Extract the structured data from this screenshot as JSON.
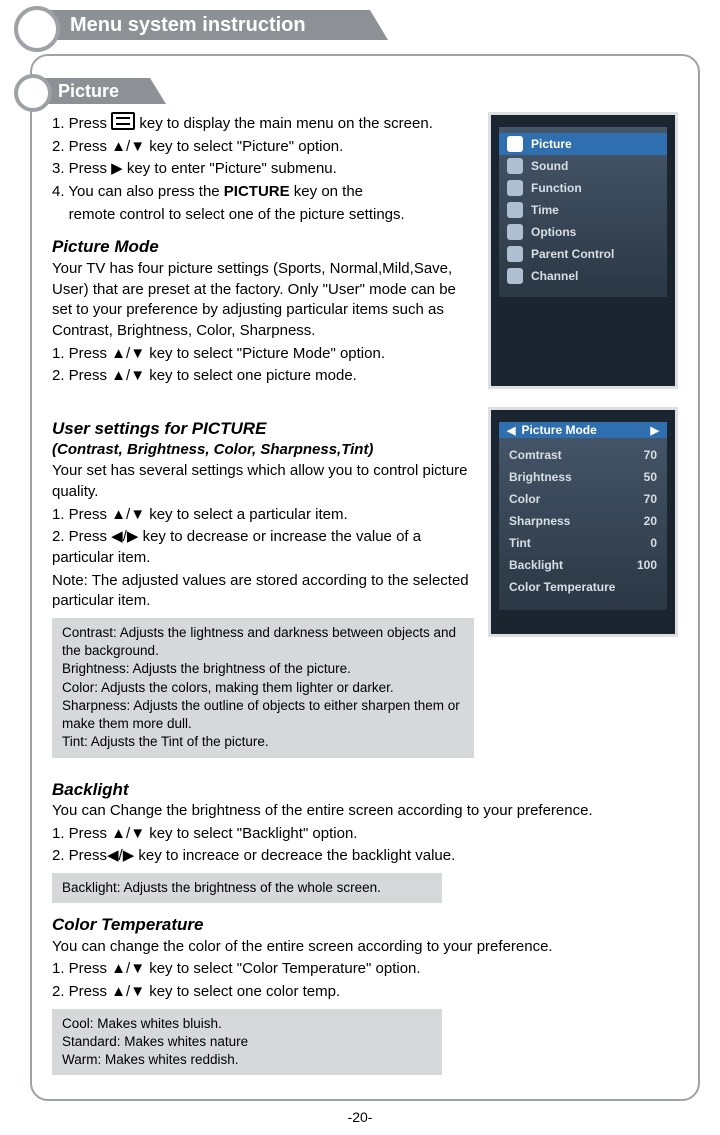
{
  "header": {
    "title": "Menu system instruction"
  },
  "section": {
    "label": "Picture"
  },
  "intro": {
    "l1a": "1. Press ",
    "l1b": " key to display the main menu on the screen.",
    "l2": "2. Press ▲/▼ key to select \"Picture\" option.",
    "l3": "3. Press ▶ key to enter \"Picture\" submenu.",
    "l4a": "4. You can also press the ",
    "l4b": "PICTURE",
    "l4c": " key on the",
    "l5": "    remote control to select one of the picture settings."
  },
  "pmode": {
    "h": "Picture Mode",
    "p1": "Your TV has four picture settings (Sports, Normal,Mild,Save, User) that are preset at the factory. Only \"User\" mode can be set to your preference by adjusting particular items such as Contrast, Brightness, Color, Sharpness.",
    "s1": "1. Press ▲/▼ key to select \"Picture Mode\" option.",
    "s2": "2. Press ▲/▼ key to select one picture mode."
  },
  "usettings": {
    "h": "User settings for PICTURE",
    "sub": "(Contrast, Brightness, Color, Sharpness,Tint)",
    "p1": "Your set has several settings which allow you to control picture  quality.",
    "s1": "1. Press ▲/▼ key to select a particular item.",
    "s2": "2. Press ◀/▶ key to decrease or increase the value of a particular  item.",
    "note": "Note: The adjusted values are stored according to the selected particular item."
  },
  "defs": {
    "l1": "Contrast: Adjusts the lightness and darkness between objects and the background.",
    "l2": "Brightness: Adjusts the brightness of the picture.",
    "l3": "Color: Adjusts the colors, making them lighter or darker.",
    "l4": "Sharpness: Adjusts the outline of objects to either sharpen them or make them more dull.",
    "l5": "Tint: Adjusts the Tint of the picture."
  },
  "backlight": {
    "h": "Backlight",
    "p1": "You can Change the brightness of the entire screen according to your preference.",
    "s1": "1. Press ▲/▼ key to select \"Backlight\" option.",
    "s2": "2. Press◀/▶ key to increace or decreace the backlight value.",
    "box": "Backlight: Adjusts the brightness of the whole screen."
  },
  "coltemp": {
    "h": "Color Temperature",
    "p1": "You can change the color of the entire screen  according to your preference.",
    "s1": "1. Press ▲/▼ key to select \"Color Temperature\" option.",
    "s2": "2. Press ▲/▼ key to select one color temp.",
    "b1": "Cool: Makes whites bluish.",
    "b2": "Standard: Makes whites nature",
    "b3": "Warm: Makes whites reddish."
  },
  "osd1": {
    "items": [
      "Picture",
      "Sound",
      "Function",
      "Time",
      "Options",
      "Parent  Control",
      "Channel"
    ]
  },
  "osd2": {
    "title": "Picture Mode",
    "rows": [
      {
        "k": "Comtrast",
        "v": "70"
      },
      {
        "k": "Brightness",
        "v": "50"
      },
      {
        "k": "Color",
        "v": "70"
      },
      {
        "k": "Sharpness",
        "v": "20"
      },
      {
        "k": "Tint",
        "v": "0"
      },
      {
        "k": "Backlight",
        "v": "100"
      },
      {
        "k": "Color Temperature",
        "v": ""
      }
    ]
  },
  "pagenum": "-20-"
}
